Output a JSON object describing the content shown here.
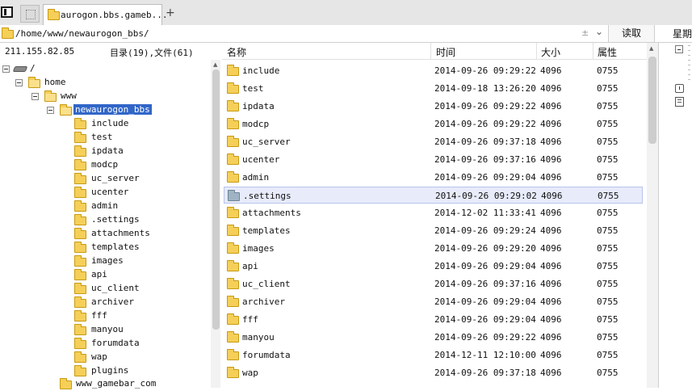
{
  "tabs": {
    "active_title": "aurogon.bbs.gameb...",
    "new_tab_symbol": "+"
  },
  "address": {
    "path": "/home/www/newaurogon_bbs/",
    "plusminus": "±",
    "dropdown": "⌄",
    "read_button": "读取",
    "weekday_label": "星期"
  },
  "tree": {
    "ip": "211.155.82.85",
    "counts": "目录(19),文件(61)",
    "root": "/",
    "home": "home",
    "www": "www",
    "selected": "newaurogon_bbs",
    "children": [
      "include",
      "test",
      "ipdata",
      "modcp",
      "uc_server",
      "ucenter",
      "admin",
      ".settings",
      "attachments",
      "templates",
      "images",
      "api",
      "uc_client",
      "archiver",
      "fff",
      "manyou",
      "forumdata",
      "wap",
      "plugins"
    ],
    "sibling": "www_gamebar_com"
  },
  "list": {
    "headers": {
      "name": "名称",
      "time": "时间",
      "size": "大小",
      "perm": "属性"
    },
    "highlighted_index": 7,
    "rows": [
      {
        "name": "include",
        "time": "2014-09-26 09:29:22",
        "size": "4096",
        "perm": "0755"
      },
      {
        "name": "test",
        "time": "2014-09-18 13:26:20",
        "size": "4096",
        "perm": "0755"
      },
      {
        "name": "ipdata",
        "time": "2014-09-26 09:29:22",
        "size": "4096",
        "perm": "0755"
      },
      {
        "name": "modcp",
        "time": "2014-09-26 09:29:22",
        "size": "4096",
        "perm": "0755"
      },
      {
        "name": "uc_server",
        "time": "2014-09-26 09:37:18",
        "size": "4096",
        "perm": "0755"
      },
      {
        "name": "ucenter",
        "time": "2014-09-26 09:37:16",
        "size": "4096",
        "perm": "0755"
      },
      {
        "name": "admin",
        "time": "2014-09-26 09:29:04",
        "size": "4096",
        "perm": "0755"
      },
      {
        "name": ".settings",
        "time": "2014-09-26 09:29:02",
        "size": "4096",
        "perm": "0755"
      },
      {
        "name": "attachments",
        "time": "2014-12-02 11:33:41",
        "size": "4096",
        "perm": "0755"
      },
      {
        "name": "templates",
        "time": "2014-09-26 09:29:24",
        "size": "4096",
        "perm": "0755"
      },
      {
        "name": "images",
        "time": "2014-09-26 09:29:20",
        "size": "4096",
        "perm": "0755"
      },
      {
        "name": "api",
        "time": "2014-09-26 09:29:04",
        "size": "4096",
        "perm": "0755"
      },
      {
        "name": "uc_client",
        "time": "2014-09-26 09:37:16",
        "size": "4096",
        "perm": "0755"
      },
      {
        "name": "archiver",
        "time": "2014-09-26 09:29:04",
        "size": "4096",
        "perm": "0755"
      },
      {
        "name": "fff",
        "time": "2014-09-26 09:29:04",
        "size": "4096",
        "perm": "0755"
      },
      {
        "name": "manyou",
        "time": "2014-09-26 09:29:22",
        "size": "4096",
        "perm": "0755"
      },
      {
        "name": "forumdata",
        "time": "2014-12-11 12:10:00",
        "size": "4096",
        "perm": "0755"
      },
      {
        "name": "wap",
        "time": "2014-09-26 09:37:18",
        "size": "4096",
        "perm": "0755"
      }
    ]
  },
  "colors": {
    "selection": "#3166c8",
    "row_highlight": "#e7ebfa",
    "folder": "#f5cf58"
  }
}
